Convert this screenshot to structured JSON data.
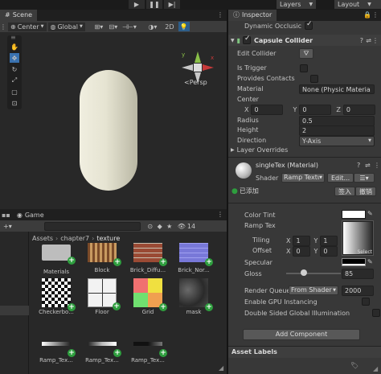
{
  "toolbar": {
    "layers_label": "Layers",
    "layout_label": "Layout"
  },
  "scene": {
    "tab_label": "Scene",
    "pivot_label": "Center",
    "space_label": "Global",
    "mode_2d": "2D",
    "persp_label": "<Persp"
  },
  "bottom_tabs": {
    "game_label": "Game",
    "count_badge": "14"
  },
  "project": {
    "breadcrumb": [
      "Assets",
      "chapter7",
      "texture"
    ],
    "assets": [
      {
        "name": "Materials",
        "icon": "folder-icon"
      },
      {
        "name": "Block",
        "icon": "block-texture"
      },
      {
        "name": "Brick_Diffu...",
        "icon": "brick-texture"
      },
      {
        "name": "Brick_Nor...",
        "icon": "brick-normal-texture"
      },
      {
        "name": "Checkerbo...",
        "icon": "checker-texture"
      },
      {
        "name": "Floor",
        "icon": "floor-texture"
      },
      {
        "name": "Grid",
        "icon": "grid-texture"
      },
      {
        "name": "mask",
        "icon": "mask-texture"
      },
      {
        "name": "Ramp_Tex...",
        "icon": "ramp-texture"
      },
      {
        "name": "Ramp_Tex...",
        "icon": "ramp-texture"
      },
      {
        "name": "Ramp_Tex...",
        "icon": "ramp-texture"
      }
    ]
  },
  "inspector": {
    "tab_label": "Inspector",
    "dynamic_occlusion_label": "Dynamic Occlusic",
    "capsule": {
      "title": "Capsule Collider",
      "edit_collider_label": "Edit Collider",
      "is_trigger_label": "Is Trigger",
      "provides_contacts_label": "Provides Contacts",
      "material_label": "Material",
      "material_value": "None (Physic Materia",
      "center_label": "Center",
      "center_x": "0",
      "center_y": "0",
      "center_z": "0",
      "x_label": "X",
      "y_label": "Y",
      "z_label": "Z",
      "radius_label": "Radius",
      "radius_value": "0.5",
      "height_label": "Height",
      "height_value": "2",
      "direction_label": "Direction",
      "direction_value": "Y-Axis",
      "layer_overrides_label": "Layer Overrides"
    },
    "material": {
      "title": "singleTex (Material)",
      "shader_label": "Shader",
      "shader_value": "Ramp Textu",
      "edit_label": "Edit...",
      "added_label": "已添加",
      "sign_in_label": "签入",
      "revoke_label": "撤销",
      "color_tint_label": "Color Tint",
      "ramp_tex_label": "Ramp Tex",
      "tiling_label": "Tiling",
      "tiling_x": "1",
      "tiling_y": "1",
      "offset_label": "Offset",
      "offset_x": "0",
      "offset_y": "0",
      "select_label": "Select",
      "specular_label": "Specular",
      "gloss_label": "Gloss",
      "gloss_value": "85",
      "gloss_fraction": 0.33,
      "render_queue_label": "Render Queue",
      "render_queue_mode": "From Shader",
      "render_queue_value": "2000",
      "gpu_instancing_label": "Enable GPU Instancing",
      "double_sided_label": "Double Sided Global Illumination",
      "add_component_label": "Add Component",
      "asset_labels_label": "Asset Labels"
    }
  },
  "colors": {
    "accent_blue": "#3a72b0",
    "add_green": "#2e9e3e"
  }
}
